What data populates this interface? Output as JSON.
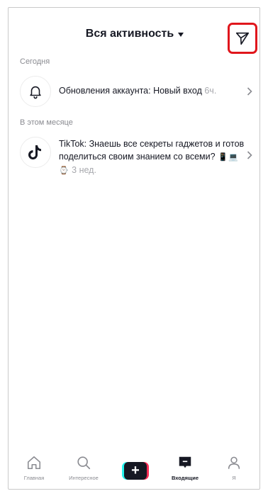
{
  "header": {
    "title": "Вся активность",
    "dm_icon": "send-icon",
    "highlight_color": "#e0161c"
  },
  "sections": {
    "today": "Сегодня",
    "this_month": "В этом месяце"
  },
  "notifications": [
    {
      "icon": "bell-icon",
      "title": "Обновления аккаунта:",
      "message": " Новый вход",
      "time": "6ч."
    },
    {
      "icon": "tiktok-logo-icon",
      "title": "TikTok:",
      "message": " Знаешь все секреты гаджетов и готов поделиться своим знанием со всеми?",
      "emoji": " 📱💻⌚",
      "time": " 3 нед."
    }
  ],
  "bottom_nav": {
    "home": "Главная",
    "discover": "Интересное",
    "inbox": "Входящие",
    "me": "Я",
    "create_symbol": "+",
    "active": "inbox"
  },
  "colors": {
    "text": "#161823",
    "muted": "#8a8b91",
    "tiktok_cyan": "#25f4ee",
    "tiktok_red": "#fe2c55"
  }
}
